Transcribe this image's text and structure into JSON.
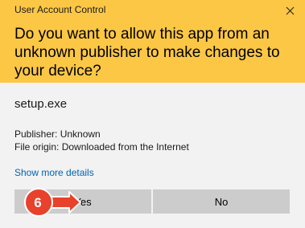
{
  "window": {
    "title": "User Account Control",
    "close_icon": "close-icon"
  },
  "header": {
    "question": "Do you want to allow this app from an unknown publisher to make changes to your device?",
    "background": "#fcc745"
  },
  "app": {
    "filename": "setup.exe",
    "publisher": "Publisher: Unknown",
    "origin": "File origin: Downloaded from the Internet"
  },
  "links": {
    "show_more": "Show more details"
  },
  "buttons": {
    "yes": "Yes",
    "no": "No"
  },
  "annotation": {
    "step": "6",
    "color": "#e8412c"
  }
}
